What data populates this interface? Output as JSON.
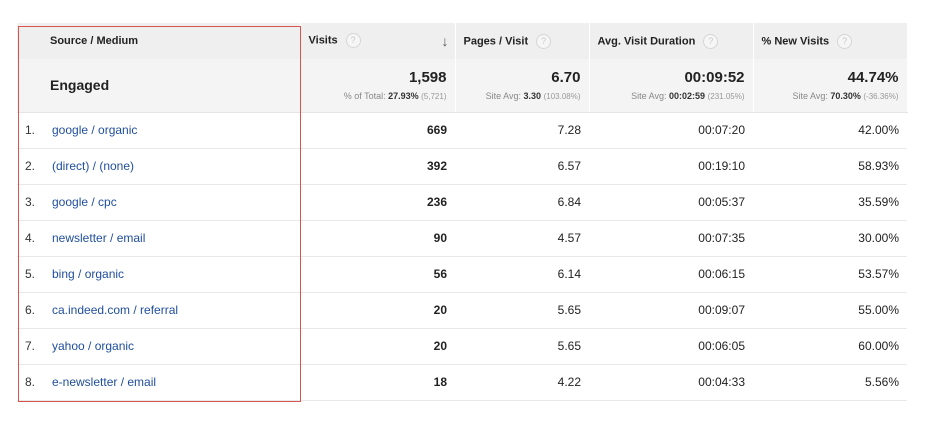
{
  "columns": {
    "source": "Source / Medium",
    "visits": "Visits",
    "pages_per_visit": "Pages / Visit",
    "avg_duration": "Avg. Visit Duration",
    "new_visits": "% New Visits",
    "help_glyph": "?"
  },
  "summary": {
    "label": "Engaged",
    "visits": "1,598",
    "visits_sub_prefix": "% of Total: ",
    "visits_sub_value": "27.93%",
    "visits_sub_extra": "(5,721)",
    "pages": "6.70",
    "pages_sub_prefix": "Site Avg: ",
    "pages_sub_value": "3.30",
    "pages_sub_extra": "(103.08%)",
    "duration": "00:09:52",
    "duration_sub_prefix": "Site Avg: ",
    "duration_sub_value": "00:02:59",
    "duration_sub_extra": "(231.05%)",
    "new": "44.74%",
    "new_sub_prefix": "Site Avg: ",
    "new_sub_value": "70.30%",
    "new_sub_extra": "(-36.36%)"
  },
  "rows": [
    {
      "index": "1.",
      "source": "google / organic",
      "visits": "669",
      "pages": "7.28",
      "duration": "00:07:20",
      "new": "42.00%"
    },
    {
      "index": "2.",
      "source": "(direct) / (none)",
      "visits": "392",
      "pages": "6.57",
      "duration": "00:19:10",
      "new": "58.93%"
    },
    {
      "index": "3.",
      "source": "google / cpc",
      "visits": "236",
      "pages": "6.84",
      "duration": "00:05:37",
      "new": "35.59%"
    },
    {
      "index": "4.",
      "source": "newsletter / email",
      "visits": "90",
      "pages": "4.57",
      "duration": "00:07:35",
      "new": "30.00%"
    },
    {
      "index": "5.",
      "source": "bing / organic",
      "visits": "56",
      "pages": "6.14",
      "duration": "00:06:15",
      "new": "53.57%"
    },
    {
      "index": "6.",
      "source": "ca.indeed.com / referral",
      "visits": "20",
      "pages": "5.65",
      "duration": "00:09:07",
      "new": "55.00%"
    },
    {
      "index": "7.",
      "source": "yahoo / organic",
      "visits": "20",
      "pages": "5.65",
      "duration": "00:06:05",
      "new": "60.00%"
    },
    {
      "index": "8.",
      "source": "e-newsletter / email",
      "visits": "18",
      "pages": "4.22",
      "duration": "00:04:33",
      "new": "5.56%"
    }
  ],
  "colors": {
    "link": "#1f4e9c",
    "highlight_border": "#d9534f",
    "header_bg": "#efefef"
  },
  "icons": {
    "sort": "sort-descending-arrow-icon",
    "help": "question-help-icon"
  }
}
